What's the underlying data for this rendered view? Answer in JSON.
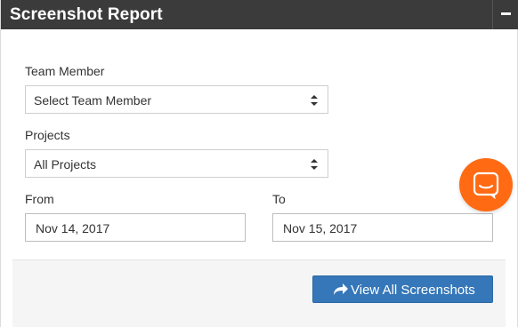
{
  "panel": {
    "title": "Screenshot Report",
    "collapse_icon": "minus-icon"
  },
  "form": {
    "team_member": {
      "label": "Team Member",
      "selected": "Select Team Member"
    },
    "projects": {
      "label": "Projects",
      "selected": "All Projects"
    },
    "from": {
      "label": "From",
      "value": "Nov 14, 2017"
    },
    "to": {
      "label": "To",
      "value": "Nov 15, 2017"
    }
  },
  "footer": {
    "view_button_label": "View All Screenshots",
    "view_button_icon": "share-arrow-icon"
  },
  "chat": {
    "icon": "chat-icon"
  },
  "colors": {
    "header_bg": "#3b3b3b",
    "primary_button": "#3577b8",
    "chat_accent": "#ff6a13"
  }
}
